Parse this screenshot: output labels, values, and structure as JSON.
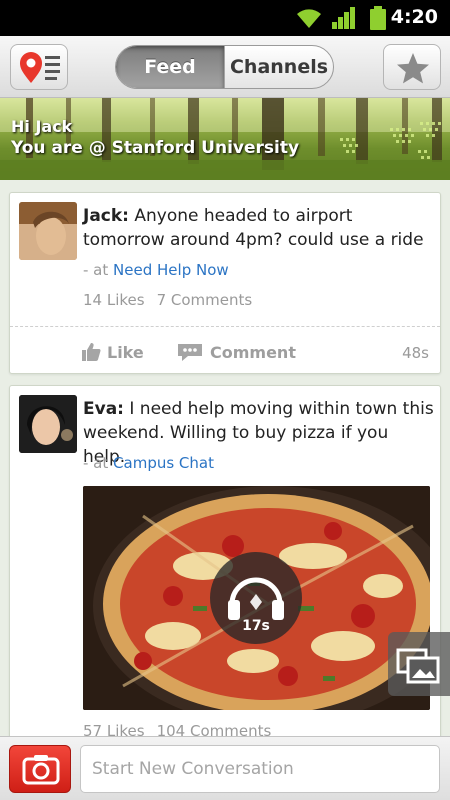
{
  "status_bar": {
    "time": "4:20"
  },
  "header": {
    "tabs": [
      {
        "label": "Feed",
        "active": true
      },
      {
        "label": "Channels",
        "active": false
      }
    ],
    "left_icon": "location-menu-icon",
    "right_icon": "star-icon"
  },
  "banner": {
    "greeting": "Hi Jack",
    "location": "You are @ Stanford University"
  },
  "posts": [
    {
      "author": "Jack:",
      "text": "Anyone headed to airport tomorrow around 4pm? could use a ride",
      "channel_prefix": "- at",
      "channel": "Need Help Now",
      "likes": "14 Likes",
      "comments": "7 Comments",
      "like_label": "Like",
      "comment_label": "Comment",
      "age": "48s"
    },
    {
      "author": "Eva:",
      "text": "I need help moving within town this weekend. Willing to buy pizza if you help.",
      "channel_prefix": "- at",
      "channel": "Campus Chat",
      "audio_duration": "17s",
      "likes": "57 Likes",
      "comments": "104 Comments"
    }
  ],
  "compose": {
    "placeholder": "Start New Conversation"
  },
  "colors": {
    "accent_red": "#e8372c",
    "link_blue": "#2b74c4",
    "background": "#e9eee5"
  }
}
